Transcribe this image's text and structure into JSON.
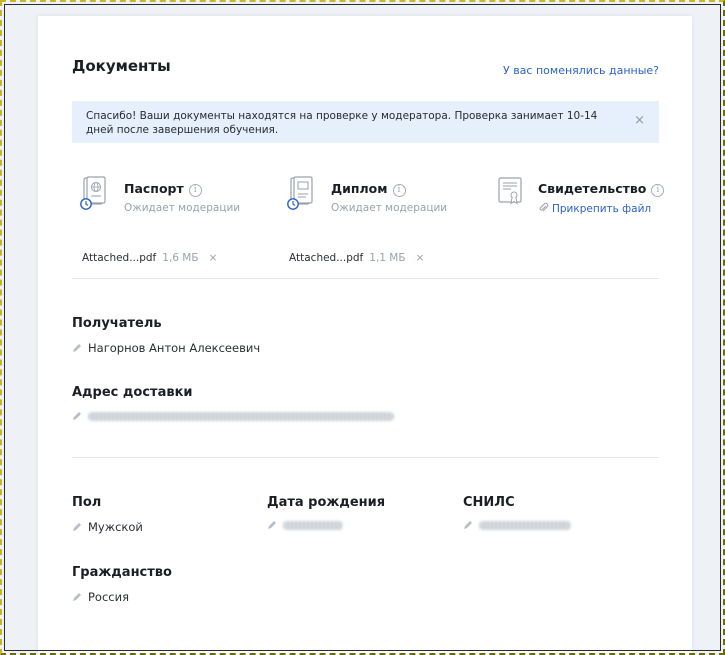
{
  "header": {
    "title": "Документы",
    "changed_link": "У вас поменялись данные?"
  },
  "notice": {
    "text": "Спасибо! Ваши документы находятся на проверке у модератора. Проверка занимает 10-14 дней после завершения обучения.",
    "close": "×"
  },
  "documents": [
    {
      "title": "Паспорт",
      "status": "Ожидает модерации",
      "file_name": "Attached...pdf",
      "file_size": "1,6 МБ",
      "remove": "×"
    },
    {
      "title": "Диплом",
      "status": "Ожидает модерации",
      "file_name": "Attached...pdf",
      "file_size": "1,1 МБ",
      "remove": "×"
    },
    {
      "title": "Свидетельство",
      "attach": "Прикрепить файл"
    }
  ],
  "info_glyph": "i",
  "recipient": {
    "label": "Получатель",
    "value": "Нагорнов Антон Алексеевич"
  },
  "address": {
    "label": "Адрес доставки"
  },
  "gender": {
    "label": "Пол",
    "value": "Мужской"
  },
  "birth_date": {
    "label": "Дата рождения"
  },
  "snils": {
    "label": "СНИЛС"
  },
  "citizenship": {
    "label": "Гражданство",
    "value": "Россия"
  },
  "colors": {
    "accent": "#2b63c9",
    "notice_bg": "#e6f0fd",
    "pending_clock": "#2b63c9"
  },
  "icons": [
    "passport-icon",
    "diploma-icon",
    "certificate-icon",
    "clock-icon",
    "info-icon",
    "paperclip-icon",
    "pencil-icon",
    "close-icon"
  ]
}
